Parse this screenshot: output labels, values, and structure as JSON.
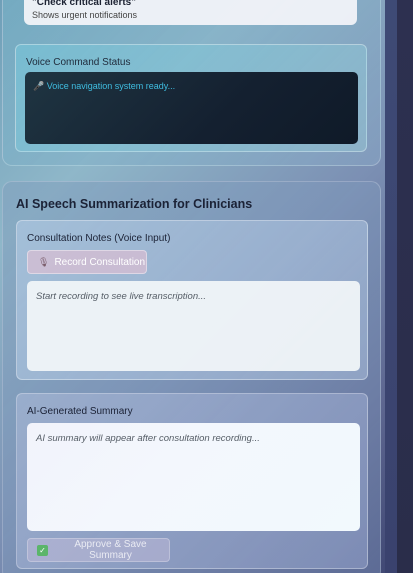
{
  "alert": {
    "title": "\"Check critical alerts\"",
    "subtitle": "Shows urgent notifications"
  },
  "voice_command": {
    "label": "Voice Command Status",
    "status": "🎤 Voice navigation system ready..."
  },
  "summarization": {
    "title": "AI Speech Summarization for Clinicians",
    "consultation": {
      "label": "Consultation Notes (Voice Input)",
      "record_button": "Record Consultation",
      "record_icon": "microphone-icon",
      "transcript_placeholder": "Start recording to see live transcription..."
    },
    "summary": {
      "label": "AI-Generated Summary",
      "placeholder": "AI summary will appear after consultation recording...",
      "approve_button": "Approve & Save Summary",
      "approve_icon": "check-icon"
    }
  },
  "colors": {
    "voice_status_text": "#3fbde0",
    "voice_screen_bg": "#142030",
    "approve_icon": "#5bb56a"
  }
}
